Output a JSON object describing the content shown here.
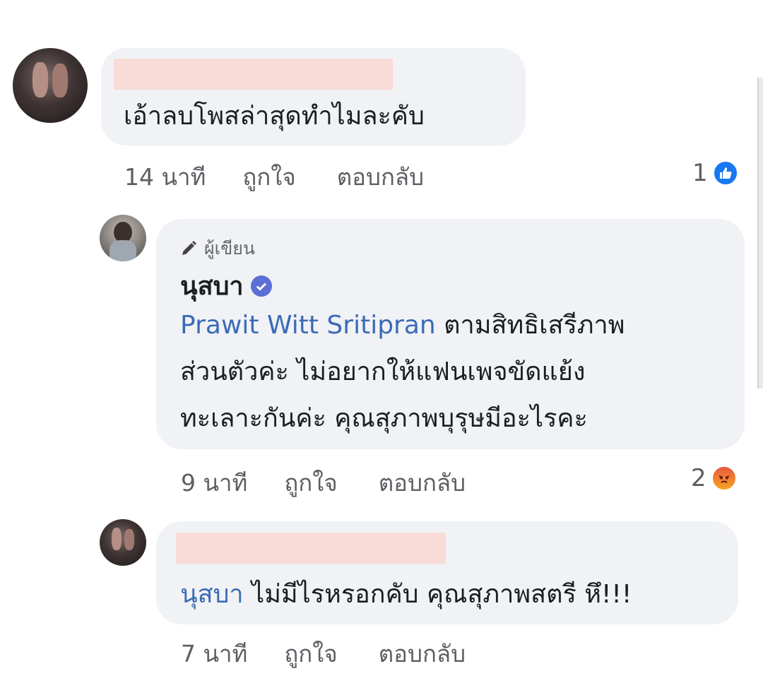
{
  "comments": [
    {
      "text": "เอ้าลบโพสล่าสุดทำไมละคับ",
      "time": "14 นาที",
      "like_label": "ถูกใจ",
      "reply_label": "ตอบกลับ",
      "reaction_count": "1",
      "reaction_icon": "like-icon"
    },
    {
      "author_badge": "ผู้เขียน",
      "name": "นุสบา",
      "mention": "Prawit Witt Sritipran",
      "text_line1": " ตามสิทธิเสรีภาพ",
      "text_line2": "ส่วนตัวค่ะ ไม่อยากให้แฟนเพจขัดแย้ง",
      "text_line3": "ทะเลาะกันค่ะ คุณสุภาพบุรุษมีอะไรคะ",
      "time": "9 นาที",
      "like_label": "ถูกใจ",
      "reply_label": "ตอบกลับ",
      "reaction_count": "2",
      "reaction_icon": "angry-icon"
    },
    {
      "mention": "นุสบา",
      "text": " ไม่มีไรหรอกคับ คุณสุภาพสตรี หึ!!!",
      "time": "7 นาที",
      "like_label": "ถูกใจ",
      "reply_label": "ตอบกลับ"
    }
  ],
  "colors": {
    "bubble": "#f0f2f5",
    "mention": "#3b6bb6",
    "redaction": "#f9dbd8",
    "like": "#1877f2",
    "verified": "#5b6fd6"
  }
}
